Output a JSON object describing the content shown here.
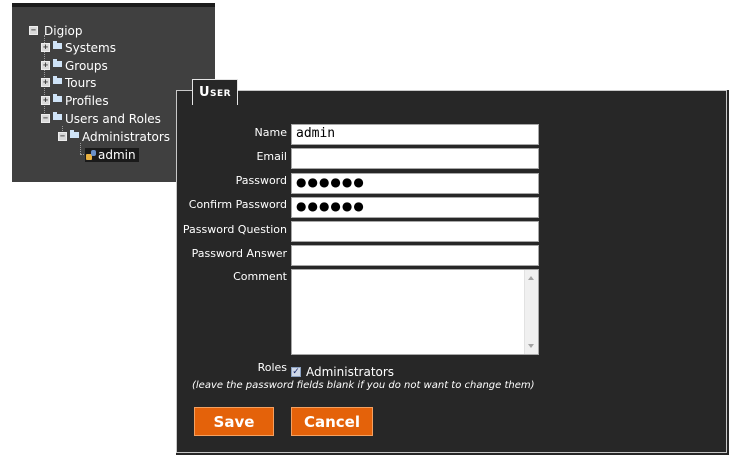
{
  "tree": {
    "root": "Digiop",
    "items": [
      {
        "label": "Systems",
        "expander": "+"
      },
      {
        "label": "Groups",
        "expander": "+"
      },
      {
        "label": "Tours",
        "expander": "+"
      },
      {
        "label": "Profiles",
        "expander": "+"
      },
      {
        "label": "Users and Roles",
        "expander": "−"
      }
    ],
    "sub": {
      "label": "Administrators",
      "expander": "−"
    },
    "leaf": "admin",
    "root_expander": "−"
  },
  "panel": {
    "title": "User",
    "fields": {
      "name": {
        "label": "Name",
        "value": "admin"
      },
      "email": {
        "label": "Email",
        "value": ""
      },
      "password": {
        "label": "Password",
        "value": "●●●●●●"
      },
      "confirm_password": {
        "label": "Confirm Password",
        "value": "●●●●●●"
      },
      "password_question": {
        "label": "Password Question",
        "value": ""
      },
      "password_answer": {
        "label": "Password Answer",
        "value": ""
      },
      "comment": {
        "label": "Comment",
        "value": ""
      }
    },
    "roles": {
      "label": "Roles",
      "option": "Administrators",
      "checked": true,
      "check_glyph": "✓"
    },
    "hint": "(leave the password fields blank if you do not want to change them)",
    "save_label": "Save",
    "cancel_label": "Cancel"
  },
  "colors": {
    "button": "#e4620a",
    "panel_bg": "#272727",
    "tree_bg": "#404040"
  }
}
